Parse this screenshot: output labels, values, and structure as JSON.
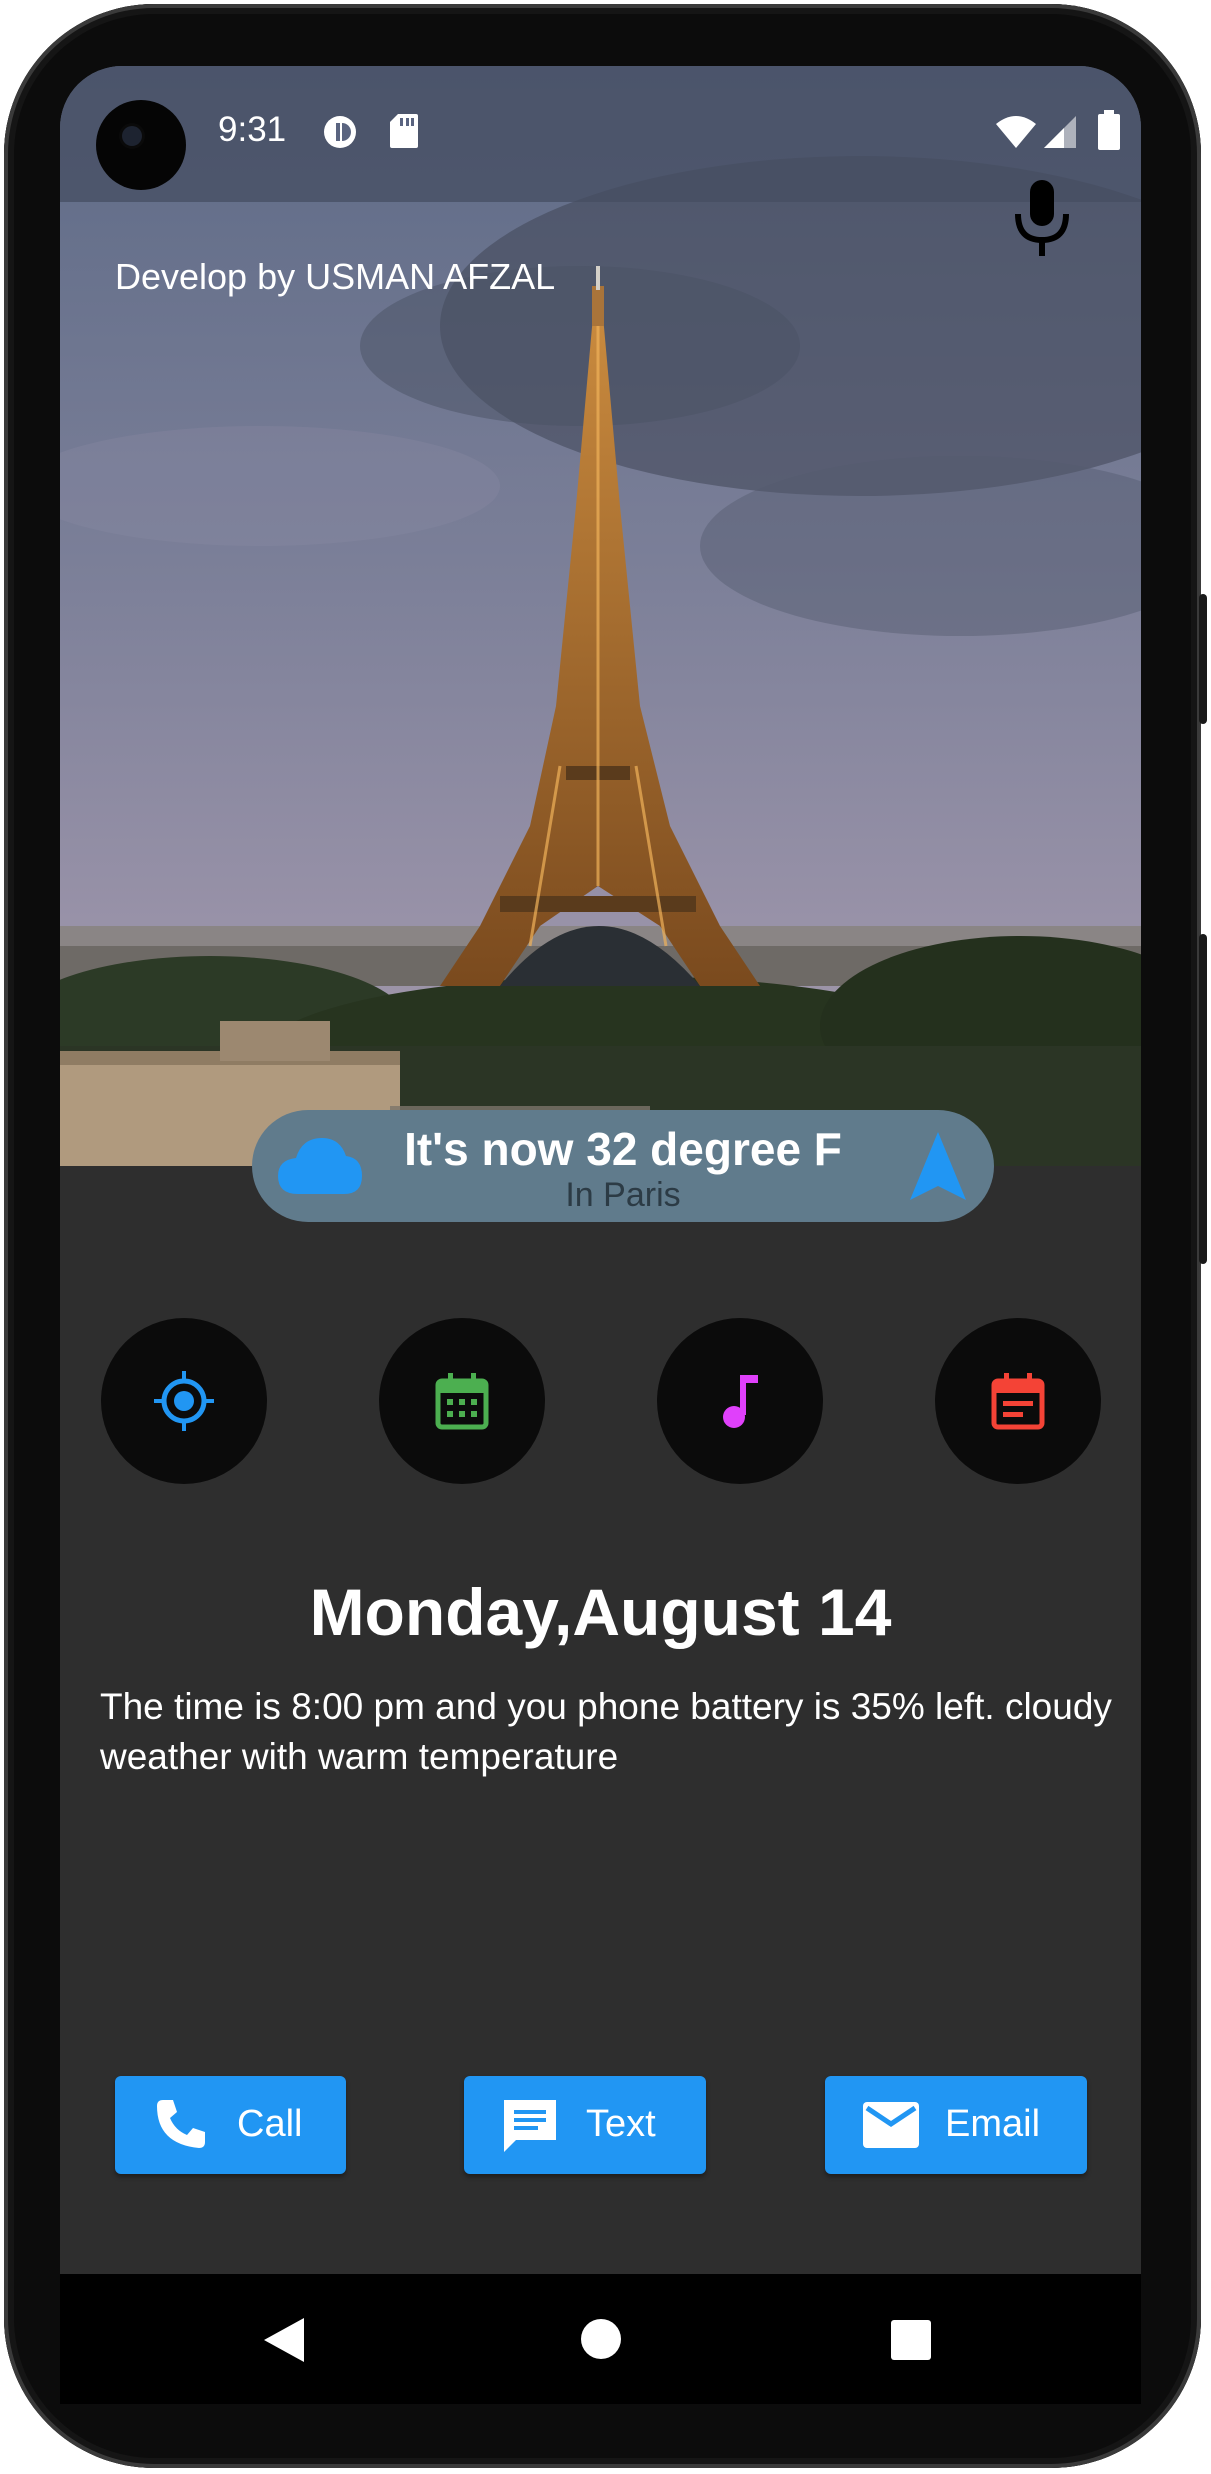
{
  "status_bar": {
    "time": "9:31",
    "left_icons": [
      "vpn-key-icon",
      "sd-card-icon"
    ],
    "right_icons": [
      "wifi-icon",
      "cellular-signal-icon",
      "battery-icon"
    ]
  },
  "header": {
    "credit": "Develop by USMAN AFZAL",
    "mic_icon": "mic-icon"
  },
  "weather": {
    "title": "It's now 32 degree F",
    "location": "In Paris",
    "left_icon": "cloud-icon",
    "right_icon": "navigation-arrow-icon",
    "pill_color": "#607b8c",
    "icon_color": "#2196f3"
  },
  "quick_actions": [
    {
      "icon": "gps-target-icon",
      "color": "#2196f3"
    },
    {
      "icon": "calendar-grid-icon",
      "color": "#4caf50"
    },
    {
      "icon": "music-note-icon",
      "color": "#e040fb"
    },
    {
      "icon": "event-note-icon",
      "color": "#f44336"
    }
  ],
  "summary": {
    "date": "Monday,August 14",
    "description": "The time is 8:00 pm and you phone battery is 35% left. cloudy weather with warm temperature"
  },
  "buttons": {
    "call_label": "Call",
    "text_label": "Text",
    "email_label": "Email",
    "color": "#2196f3"
  },
  "nav_bar": [
    "back-icon",
    "home-icon",
    "recents-icon"
  ]
}
